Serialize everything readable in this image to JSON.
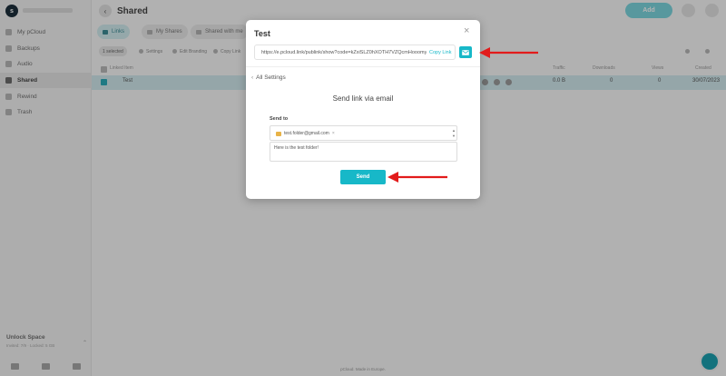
{
  "app": {
    "brand_initial": "s",
    "page_title": "Shared",
    "add_label": "Add",
    "back_glyph": "‹"
  },
  "sidebar": {
    "items": [
      {
        "label": "My pCloud",
        "active": false
      },
      {
        "label": "Backups",
        "active": false
      },
      {
        "label": "Audio",
        "active": false
      },
      {
        "label": "Shared",
        "active": true
      },
      {
        "label": "Rewind",
        "active": false
      },
      {
        "label": "Trash",
        "active": false
      }
    ],
    "unlock_title": "Unlock Space",
    "unlock_sub": "Invited: 7/9 · Locked: 5 GB"
  },
  "tabs": [
    {
      "label": "Links",
      "active": true
    },
    {
      "label": "My Shares",
      "active": false
    },
    {
      "label": "Shared with me",
      "active": false
    }
  ],
  "actions": {
    "selected": "1 selected",
    "settings": "Settings",
    "edit_branding": "Edit Branding",
    "copy_link": "Copy Link"
  },
  "table": {
    "headers": {
      "name": "Linked Item",
      "traffic": "Traffic",
      "downloads": "Downloads",
      "views": "Views",
      "created": "Created"
    },
    "rows": [
      {
        "name": "Test",
        "traffic": "0.0 B",
        "downloads": "0",
        "views": "0",
        "created": "30/07/2023"
      }
    ]
  },
  "footer_note": "pCloud. Made in Europe.",
  "modal": {
    "title": "Test",
    "close_glyph": "×",
    "link_url": "https://e.pcloud.link/publink/show?code=kZxiSLZ0hXOTH7VZQcmHooomyuUk",
    "copy_link_label": "Copy Link",
    "all_settings_label": "All Settings",
    "back_glyph": "‹",
    "send_heading": "Send link via email",
    "send_to_label": "Send to",
    "recipient": "test.folder@gmail.com",
    "remove_glyph": "×",
    "message": "Here is the test folder!",
    "send_label": "Send"
  },
  "colors": {
    "accent": "#17b8c8",
    "annotation_arrow": "#e21b1b"
  },
  "icons": {
    "email_button": "envelope-icon",
    "folder_chip": "folder-icon"
  }
}
